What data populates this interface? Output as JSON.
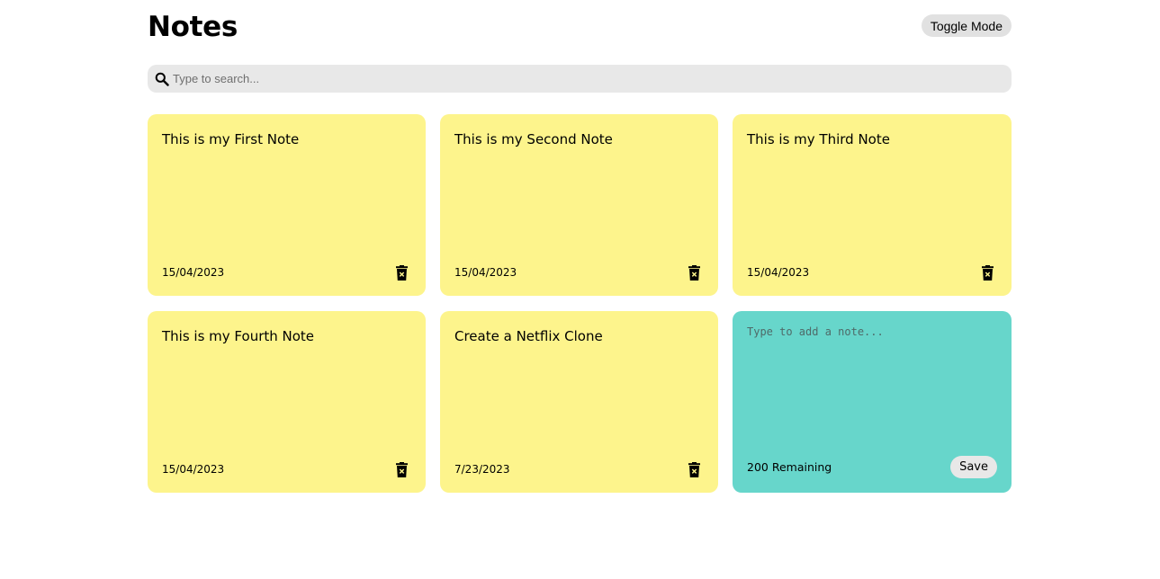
{
  "header": {
    "title": "Notes",
    "toggle_label": "Toggle Mode"
  },
  "search": {
    "placeholder": "Type to search...",
    "value": "",
    "icon": "search-icon"
  },
  "notes": [
    {
      "text": "This is my First Note",
      "date": "15/04/2023",
      "delete_icon": "delete-icon"
    },
    {
      "text": "This is my Second Note",
      "date": "15/04/2023",
      "delete_icon": "delete-icon"
    },
    {
      "text": "This is my Third Note",
      "date": "15/04/2023",
      "delete_icon": "delete-icon"
    },
    {
      "text": "This is my Fourth Note",
      "date": "15/04/2023",
      "delete_icon": "delete-icon"
    },
    {
      "text": "Create a Netflix Clone",
      "date": "7/23/2023",
      "delete_icon": "delete-icon"
    }
  ],
  "new_note": {
    "placeholder": "Type to add a note...",
    "value": "",
    "remaining_label": "200 Remaining",
    "save_label": "Save"
  },
  "colors": {
    "note_background": "#fdf48c",
    "new_note_background": "#67d6cb",
    "search_background": "#e8e8e8",
    "button_background": "#e1e1e1"
  }
}
